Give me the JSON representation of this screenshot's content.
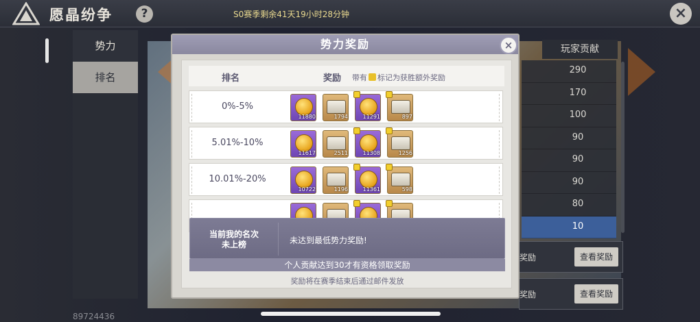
{
  "header": {
    "title": "愿晶纷争",
    "help_symbol": "?",
    "season_timer": "S0赛季剩余41天19小时28分钟",
    "close_symbol": "×"
  },
  "nav": {
    "tabs": [
      {
        "label": "势力",
        "selected": false
      },
      {
        "label": "排名",
        "selected": true
      }
    ],
    "player_id": "89724436"
  },
  "ranking": {
    "column_header": "玩家贡献",
    "values": [
      "290",
      "170",
      "100",
      "90",
      "90",
      "90",
      "80",
      "10"
    ],
    "highlighted_index": 7,
    "reward_cards": [
      {
        "label": "奖励",
        "button": "查看奖励"
      },
      {
        "label": "奖励",
        "button": "查看奖励"
      }
    ]
  },
  "modal": {
    "title": "势力奖励",
    "close_symbol": "×",
    "columns": {
      "rank": "排名",
      "reward": "奖励"
    },
    "note_prefix": "带有",
    "note_suffix": "标记为获胜额外奖励",
    "tiers": [
      {
        "range": "0%-5%",
        "items": [
          {
            "type": "coin",
            "qty": "11880",
            "bonus": false
          },
          {
            "type": "chest",
            "qty": "1794",
            "bonus": false
          },
          {
            "type": "coin",
            "qty": "11291",
            "bonus": true
          },
          {
            "type": "chest",
            "qty": "897",
            "bonus": true
          }
        ]
      },
      {
        "range": "5.01%-10%",
        "items": [
          {
            "type": "coin",
            "qty": "11617",
            "bonus": false
          },
          {
            "type": "chest",
            "qty": "2511",
            "bonus": false
          },
          {
            "type": "coin",
            "qty": "11308",
            "bonus": true
          },
          {
            "type": "chest",
            "qty": "1256",
            "bonus": true
          }
        ]
      },
      {
        "range": "10.01%-20%",
        "items": [
          {
            "type": "coin",
            "qty": "10722",
            "bonus": false
          },
          {
            "type": "chest",
            "qty": "1196",
            "bonus": false
          },
          {
            "type": "coin",
            "qty": "11361",
            "bonus": true
          },
          {
            "type": "chest",
            "qty": "598",
            "bonus": true
          }
        ]
      },
      {
        "range": "",
        "items": [
          {
            "type": "coin",
            "qty": "",
            "bonus": false
          },
          {
            "type": "chest",
            "qty": "",
            "bonus": false
          },
          {
            "type": "coin",
            "qty": "",
            "bonus": true
          },
          {
            "type": "chest",
            "qty": "",
            "bonus": true
          }
        ]
      }
    ],
    "my_rank_title": "当前我的名次",
    "my_rank_value": "未上榜",
    "my_rank_message": "未达到最低势力奖励!",
    "requirement": "个人贡献达到30才有资格领取奖励",
    "footnote": "奖励将在赛季结束后通过邮件发放"
  }
}
